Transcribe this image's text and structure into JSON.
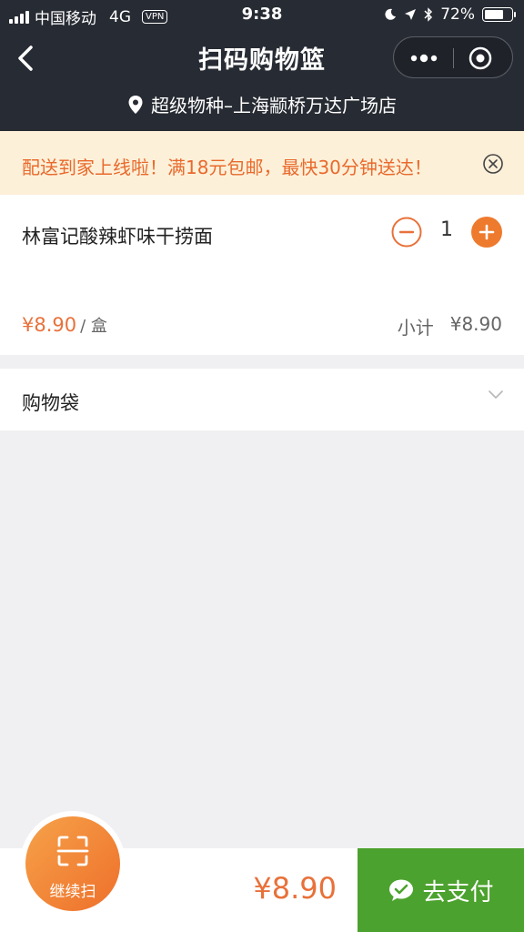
{
  "status_bar": {
    "carrier": "中国移动",
    "network": "4G",
    "vpn": "VPN",
    "time": "9:38",
    "battery": "72%",
    "battery_level": 0.72
  },
  "nav": {
    "title": "扫码购物篮",
    "back_icon": "chevron-left-icon",
    "more_icon": "more-dots-icon",
    "close_icon": "target-close-icon"
  },
  "store": {
    "name": "超级物种–上海颛桥万达广场店",
    "icon": "location-pin-icon"
  },
  "notice": {
    "text": "配送到家上线啦！满18元包邮，最快30分钟送达！",
    "close_icon": "circle-x-icon"
  },
  "cart": {
    "items": [
      {
        "name": "林富记酸辣虾味干捞面",
        "quantity": "1",
        "price": "¥8.90",
        "unit": "/ 盒",
        "subtotal_label": "小计",
        "subtotal": "¥8.90"
      }
    ]
  },
  "bag": {
    "label": "购物袋"
  },
  "footer": {
    "scan_label": "继续扫",
    "total": "¥8.90",
    "pay_label": "去支付"
  },
  "colors": {
    "header_bg": "#272b33",
    "accent_orange": "#e8713a",
    "pay_green": "#4ca22e",
    "notice_bg": "#fdf0d9"
  }
}
